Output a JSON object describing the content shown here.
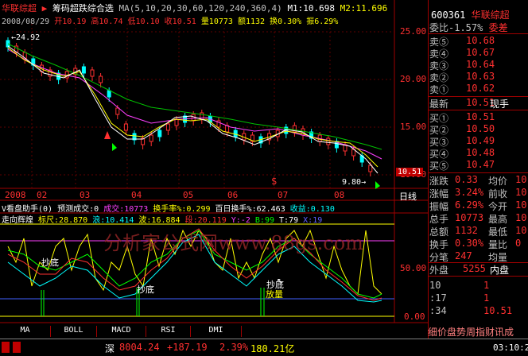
{
  "header": {
    "stock_name": "华联综超",
    "indicator_name": "筹码超跌综合选",
    "ma_params": "MA(5,10,20,30,60,120,240,360,4)",
    "ma_m1": "M1:10.698",
    "ma_m2": "M2:11.696"
  },
  "info_bar": {
    "date": "2008/08/29",
    "open": "开10.19",
    "high": "高10.74",
    "low": "低10.10",
    "close": "收10.51",
    "volume": "量10773",
    "amount": "额1132",
    "turnover": "换0.30%",
    "amplitude": "振6.29%"
  },
  "price_axis": [
    "25.00",
    "20.00",
    "15.00",
    "10.00"
  ],
  "price_marks": {
    "high_label": "24.92",
    "low_label": "9.80",
    "current": "10.51"
  },
  "time_axis": [
    "2008",
    "02",
    "03",
    "04",
    "05",
    "06",
    "07",
    "08"
  ],
  "line_label": "日线",
  "sub1": {
    "title": "V看盘助手(0)",
    "pred_vol": "预测成交:0",
    "vol": "成交:10773",
    "turn_rate": "换手率%:0.299",
    "hundred_turn": "百日换手%:62.463",
    "profit": "收益:0.130"
  },
  "sub2": {
    "title": "走向辉煌",
    "s1": "标尺:28.870",
    "s2": "浪:10.414",
    "s3": "波:16.884",
    "s4": "段:20.119",
    "s5": "Y:-2",
    "s6": "B:99",
    "s7": "T:79",
    "s8": "X:19",
    "axis": [
      "50.00",
      "0.00"
    ],
    "labels": [
      "抄底",
      "抄底",
      "抄底",
      "放量"
    ]
  },
  "watermark": "分析家公式网www.88gs.com",
  "tabs": [
    "MA",
    "BOLL",
    "MACD",
    "RSI",
    "DMI"
  ],
  "status_bar": {
    "index_label": "深",
    "index_value": "8004.24",
    "change": "+187.19",
    "pct": "2.39%",
    "amount": "180.21亿",
    "time": "03:10:2"
  },
  "right_panel": {
    "code": "600361",
    "name": "华联综超",
    "weibi": "委比-1.57%",
    "weicha": "委差",
    "sells": [
      {
        "label": "卖⑤",
        "price": "10.68"
      },
      {
        "label": "卖④",
        "price": "10.67"
      },
      {
        "label": "卖③",
        "price": "10.64"
      },
      {
        "label": "卖②",
        "price": "10.63"
      },
      {
        "label": "卖①",
        "price": "10.62"
      }
    ],
    "latest_label": "最新",
    "latest_price": "10.51",
    "latest_suffix": "现手",
    "buys": [
      {
        "label": "买①",
        "price": "10.51"
      },
      {
        "label": "买②",
        "price": "10.50"
      },
      {
        "label": "买③",
        "price": "10.49"
      },
      {
        "label": "买④",
        "price": "10.48"
      },
      {
        "label": "买⑤",
        "price": "10.47"
      }
    ],
    "stats": [
      {
        "l1": "涨跌",
        "v1": "0.33",
        "l2": "均价",
        "v2": "10"
      },
      {
        "l1": "涨幅",
        "v1": "3.24%",
        "l2": "前收",
        "v2": "10"
      },
      {
        "l1": "振幅",
        "v1": "6.29%",
        "l2": "今开",
        "v2": "10"
      },
      {
        "l1": "总手",
        "v1": "10773",
        "l2": "最高",
        "v2": "10"
      },
      {
        "l1": "总额",
        "v1": "1132",
        "l2": "最低",
        "v2": "10"
      },
      {
        "l1": "换手",
        "v1": "0.30%",
        "l2": "量比",
        "v2": "0"
      },
      {
        "l1": "分笔",
        "v1": "247",
        "l2": "均量",
        "v2": ""
      }
    ],
    "outer_label": "外盘",
    "outer_value": "5255",
    "inner_label": "内盘",
    "ticks": [
      {
        "t": "10",
        "v": "1"
      },
      {
        "t": ":17",
        "v": "1"
      },
      {
        "t": ":34",
        "v": "10.51"
      }
    ],
    "bottom_tabs": "细价盘势周指财讯成"
  }
}
